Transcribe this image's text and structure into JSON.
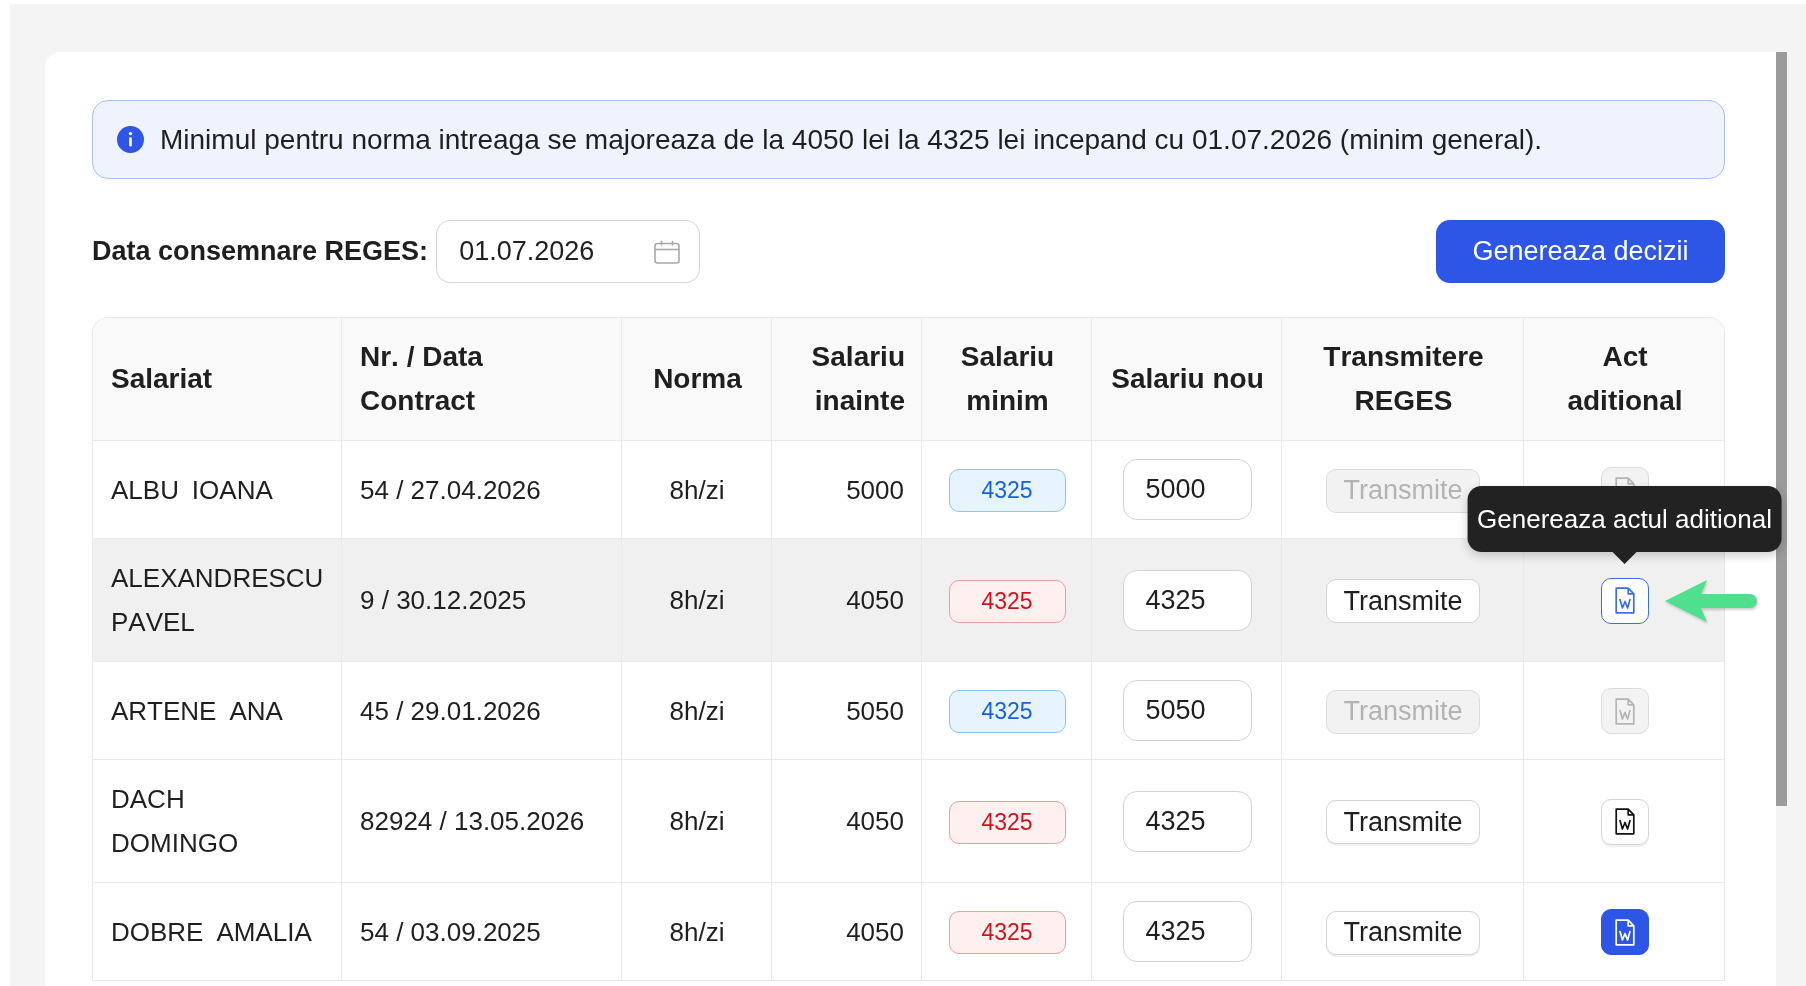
{
  "info_alert": {
    "text": "Minimul pentru norma intreaga se majoreaza de la 4050 lei la 4325 lei incepand cu 01.07.2026 (minim general)."
  },
  "toolbar": {
    "date_label": "Data consemnare REGES:",
    "date_field": {
      "value": "01.07.2026"
    },
    "generate_button": "Genereaza decizii"
  },
  "table": {
    "columns": [
      "Salariat",
      "Nr. / Data Contract",
      "Norma",
      "Salariu inainte",
      "Salariu minim",
      "Salariu nou",
      "Transmitere REGES",
      "Act aditional"
    ],
    "rows": [
      {
        "hovered": false,
        "employee": "ALBU IOANA",
        "contract": "54 / 27.04.2026",
        "norm": "8h/zi",
        "salary_before": "5000",
        "salary_min": {
          "text": "4325",
          "below_minimum": false
        },
        "salary_new": "5000",
        "transmit": {
          "label": "Transmite",
          "disabled": true
        },
        "act": {
          "disabled": true,
          "focused": false,
          "filled": false,
          "marked": false
        }
      },
      {
        "hovered": true,
        "employee": "ALEXANDRESCU PAVEL",
        "contract": "9 / 30.12.2025",
        "norm": "8h/zi",
        "salary_before": "4050",
        "salary_min": {
          "text": "4325",
          "below_minimum": true
        },
        "salary_new": "4325",
        "transmit": {
          "label": "Transmite",
          "disabled": false
        },
        "act": {
          "disabled": false,
          "focused": true,
          "filled": false,
          "tooltip": "Genereaza actul aditional",
          "marked": true
        }
      },
      {
        "hovered": false,
        "employee": "ARTENE ANA",
        "contract": "45 / 29.01.2026",
        "norm": "8h/zi",
        "salary_before": "5050",
        "salary_min": {
          "text": "4325",
          "below_minimum": false
        },
        "salary_new": "5050",
        "transmit": {
          "label": "Transmite",
          "disabled": true
        },
        "act": {
          "disabled": true,
          "focused": false,
          "filled": false,
          "marked": false
        }
      },
      {
        "hovered": false,
        "employee": "DACH DOMINGO",
        "contract": "82924 / 13.05.2026",
        "norm": "8h/zi",
        "salary_before": "4050",
        "salary_min": {
          "text": "4325",
          "below_minimum": true
        },
        "salary_new": "4325",
        "transmit": {
          "label": "Transmite",
          "disabled": false
        },
        "act": {
          "disabled": false,
          "focused": false,
          "filled": false,
          "marked": false
        }
      },
      {
        "hovered": false,
        "employee": "DOBRE AMALIA",
        "contract": "54 / 03.09.2025",
        "norm": "8h/zi",
        "salary_before": "4050",
        "salary_min": {
          "text": "4325",
          "below_minimum": true
        },
        "salary_new": "4325",
        "transmit": {
          "label": "Transmite",
          "disabled": false
        },
        "act": {
          "disabled": false,
          "focused": false,
          "filled": true,
          "marked": false
        }
      }
    ]
  }
}
